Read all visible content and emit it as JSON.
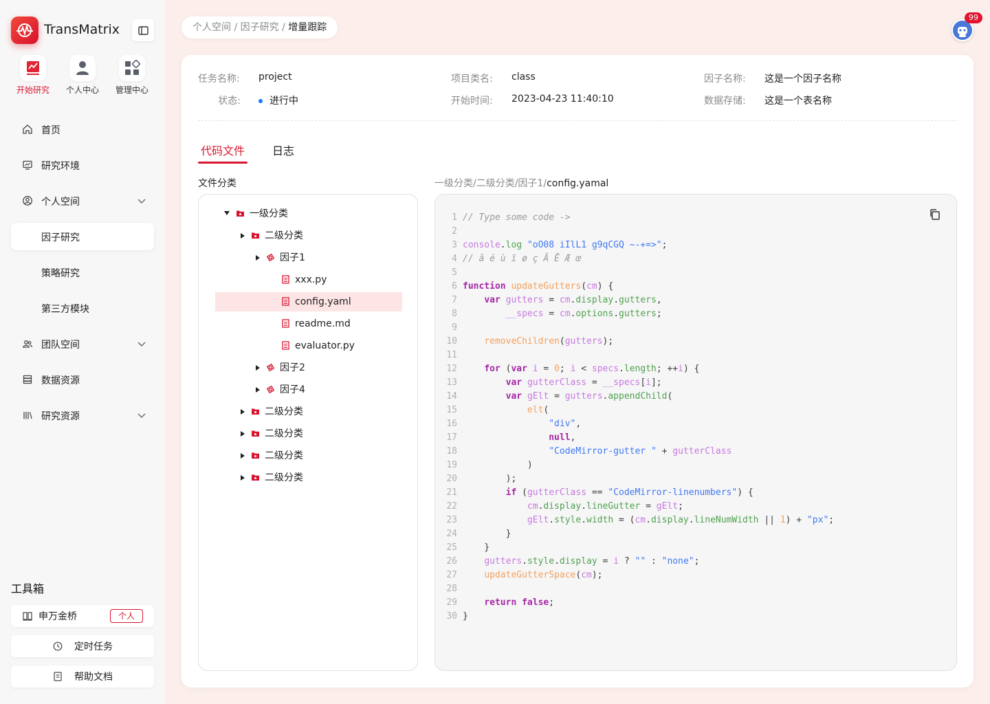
{
  "app": {
    "name": "TransMatrix"
  },
  "quick_nav": [
    {
      "label": "开始研究",
      "icon": "chart-icon",
      "active": true
    },
    {
      "label": "个人中心",
      "icon": "user-icon",
      "active": false
    },
    {
      "label": "管理中心",
      "icon": "grid-icon",
      "active": false
    }
  ],
  "nav": [
    {
      "label": "首页",
      "icon": "home-icon"
    },
    {
      "label": "研究环境",
      "icon": "monitor-icon"
    },
    {
      "label": "个人空间",
      "icon": "user-circle-icon",
      "expandable": true
    },
    {
      "label": "因子研究",
      "active": true
    },
    {
      "label": "策略研究"
    },
    {
      "label": "第三方模块"
    },
    {
      "label": "团队空间",
      "icon": "team-icon",
      "expandable": true
    },
    {
      "label": "数据资源",
      "icon": "database-icon"
    },
    {
      "label": "研究资源",
      "icon": "library-icon",
      "expandable": true
    }
  ],
  "toolbox": {
    "title": "工具箱",
    "items": [
      {
        "label": "申万金桥",
        "badge": "个人"
      },
      {
        "label": "定时任务"
      },
      {
        "label": "帮助文档"
      }
    ]
  },
  "breadcrumb": {
    "items": [
      "个人空间",
      "因子研究"
    ],
    "separator": "/",
    "current": "增量跟踪"
  },
  "notifications": {
    "count": "99"
  },
  "task_info": {
    "task_name_label": "任务名称:",
    "task_name": "project",
    "project_label": "项目类名:",
    "project": "class",
    "factor_label": "因子名称:",
    "factor": "这是一个因子名称",
    "status_label": "状态:",
    "status": "进行中",
    "status_color": "#1677ff",
    "start_label": "开始时间:",
    "start": "2023-04-23 11:40:10",
    "storage_label": "数据存储:",
    "storage": "这是一个表名称"
  },
  "tabs": [
    {
      "label": "代码文件",
      "active": true
    },
    {
      "label": "日志",
      "active": false
    }
  ],
  "file_panel_title": "文件分类",
  "file_tree": [
    {
      "label": "一级分类",
      "type": "folder",
      "expanded": true
    },
    {
      "label": "二级分类",
      "type": "folder",
      "expanded": false
    },
    {
      "label": "因子1",
      "type": "factor",
      "expanded": false
    },
    {
      "label": "xxx.py",
      "type": "file"
    },
    {
      "label": "config.yaml",
      "type": "file",
      "selected": true
    },
    {
      "label": "readme.md",
      "type": "file"
    },
    {
      "label": "evaluator.py",
      "type": "file"
    },
    {
      "label": "因子2",
      "type": "factor",
      "expanded": false
    },
    {
      "label": "因子4",
      "type": "factor",
      "expanded": false
    },
    {
      "label": "二级分类",
      "type": "folder",
      "expanded": false
    },
    {
      "label": "二级分类",
      "type": "folder",
      "expanded": false
    },
    {
      "label": "二级分类",
      "type": "folder",
      "expanded": false
    },
    {
      "label": "二级分类",
      "type": "folder",
      "expanded": false
    }
  ],
  "file_path": {
    "prefix": "一级分类/二级分类/因子1/",
    "file": "config.yamal"
  },
  "code_lines": [
    "// Type some code ->",
    "",
    "console.log \"oO08 iIlL1 g9qCGQ ~-+=>\";",
    "// â é ù ï ø ç Ã Ē Æ œ",
    "",
    "function updateGutters(cm) {",
    "    var gutters = cm.display.gutters,",
    "        __specs = cm.options.gutters;",
    "",
    "    removeChildren(gutters);",
    "",
    "    for (var i = 0; i < specs.length; ++i) {",
    "        var gutterClass = __specs[i];",
    "        var gElt = gutters.appendChild(",
    "            elt(",
    "                \"div\",",
    "                null,",
    "                \"CodeMirror-gutter \" + gutterClass",
    "            )",
    "        );",
    "        if (gutterClass == \"CodeMirror-linenumbers\") {",
    "            cm.display.lineGutter = gElt;",
    "            gElt.style.width = (cm.display.lineNumWidth || 1) + \"px\";",
    "        }",
    "    }",
    "    gutters.style.display = i ? \"\" : \"none\";",
    "    updateGutterSpace(cm);",
    "",
    "    return false;",
    "}"
  ],
  "colors": {
    "accent": "#d8152f",
    "keyword": "#a626a4",
    "string": "#4078f2",
    "property": "#50a14f",
    "function": "#f5a05a",
    "variable": "#c678dd"
  }
}
